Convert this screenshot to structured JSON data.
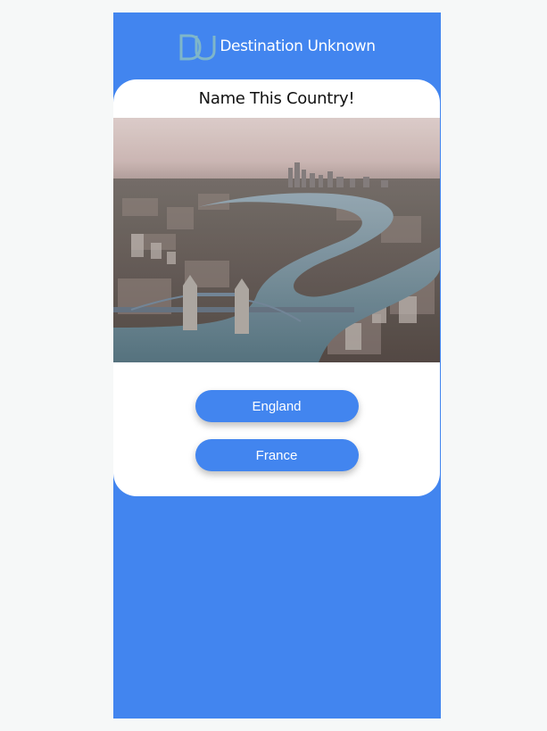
{
  "app": {
    "title": "Destination Unknown",
    "logo_icon": "du-monogram-logo"
  },
  "quiz": {
    "question": "Name This Country!",
    "image_icon": "city-river-aerial-photo",
    "answers": [
      {
        "label": "England"
      },
      {
        "label": "France"
      }
    ]
  },
  "colors": {
    "brand_blue": "#4285ef",
    "card_bg": "#ffffff",
    "page_bg": "#f6f8f8"
  }
}
